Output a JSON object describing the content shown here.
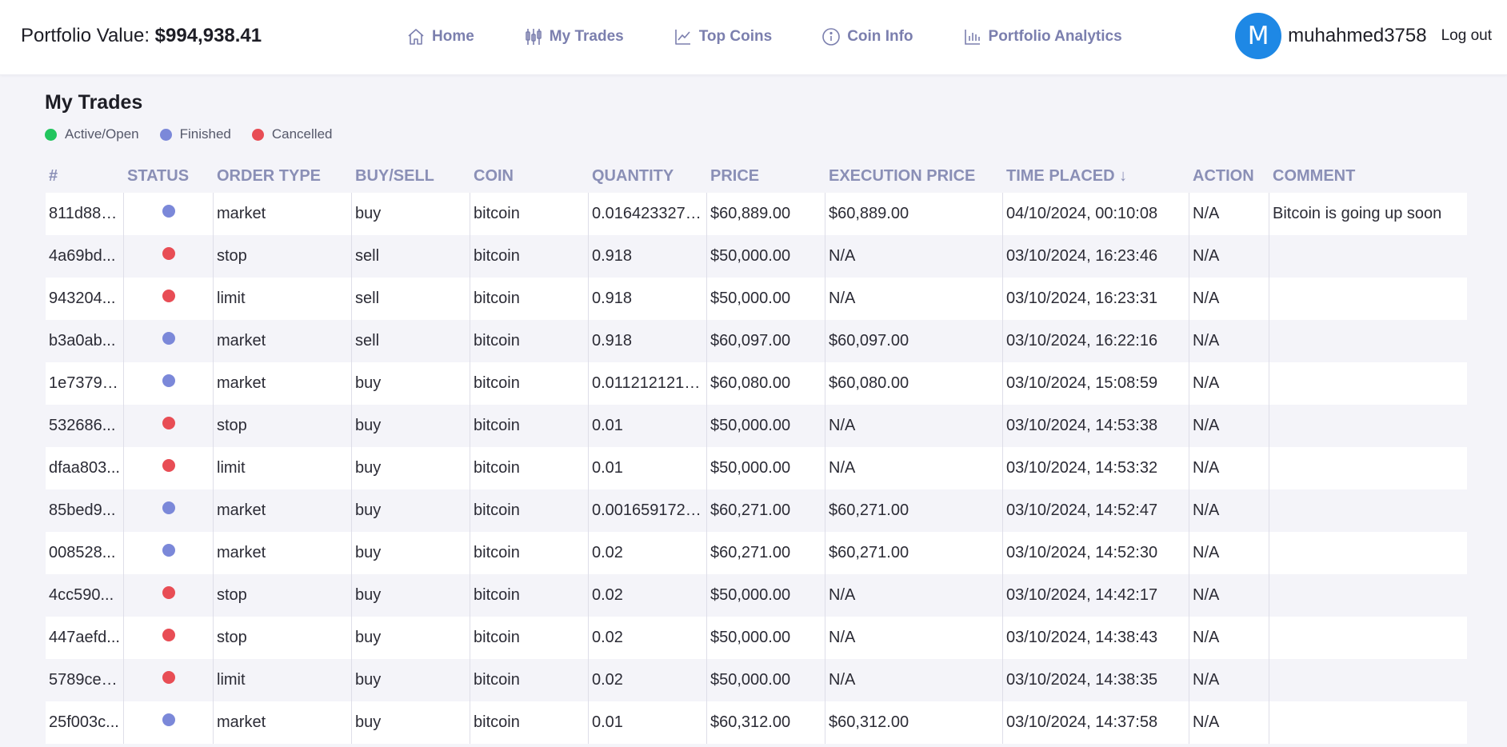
{
  "header": {
    "portfolio_label": "Portfolio Value:",
    "portfolio_value": "$994,938.41",
    "nav": [
      {
        "label": "Home",
        "icon": "home-icon"
      },
      {
        "label": "My Trades",
        "icon": "trades-icon"
      },
      {
        "label": "Top Coins",
        "icon": "chart-line-icon"
      },
      {
        "label": "Coin Info",
        "icon": "info-icon"
      },
      {
        "label": "Portfolio Analytics",
        "icon": "bar-chart-icon"
      }
    ],
    "avatar_letter": "M",
    "username": "muhahmed3758",
    "logout": "Log out"
  },
  "page": {
    "title": "My Trades",
    "legend": [
      {
        "label": "Active/Open",
        "color": "#22c55e"
      },
      {
        "label": "Finished",
        "color": "#7b88d9"
      },
      {
        "label": "Cancelled",
        "color": "#e84d55"
      }
    ]
  },
  "colors": {
    "finished": "#7b88d9",
    "cancelled": "#e84d55",
    "nav_text": "#7b7fae",
    "header_text": "#8a8fb6",
    "avatar": "#1e88e5"
  },
  "table": {
    "columns": [
      "#",
      "STATUS",
      "ORDER TYPE",
      "BUY/SELL",
      "COIN",
      "QUANTITY",
      "PRICE",
      "EXECUTION PRICE",
      "TIME PLACED ↓",
      "ACTION",
      "COMMENT"
    ],
    "rows": [
      {
        "id": "811d88e...",
        "status": "finished",
        "order_type": "market",
        "side": "buy",
        "coin": "bitcoin",
        "quantity": "0.0164233276...",
        "price": "$60,889.00",
        "exec_price": "$60,889.00",
        "time": "04/10/2024, 00:10:08",
        "action": "N/A",
        "comment": "Bitcoin is going up soon"
      },
      {
        "id": "4a69bd...",
        "status": "cancelled",
        "order_type": "stop",
        "side": "sell",
        "coin": "bitcoin",
        "quantity": "0.918",
        "price": "$50,000.00",
        "exec_price": "N/A",
        "time": "03/10/2024, 16:23:46",
        "action": "N/A",
        "comment": ""
      },
      {
        "id": "943204...",
        "status": "cancelled",
        "order_type": "limit",
        "side": "sell",
        "coin": "bitcoin",
        "quantity": "0.918",
        "price": "$50,000.00",
        "exec_price": "N/A",
        "time": "03/10/2024, 16:23:31",
        "action": "N/A",
        "comment": ""
      },
      {
        "id": "b3a0ab...",
        "status": "finished",
        "order_type": "market",
        "side": "sell",
        "coin": "bitcoin",
        "quantity": "0.918",
        "price": "$60,097.00",
        "exec_price": "$60,097.00",
        "time": "03/10/2024, 16:22:16",
        "action": "N/A",
        "comment": ""
      },
      {
        "id": "1e73791...",
        "status": "finished",
        "order_type": "market",
        "side": "buy",
        "coin": "bitcoin",
        "quantity": "0.0112121212121...",
        "price": "$60,080.00",
        "exec_price": "$60,080.00",
        "time": "03/10/2024, 15:08:59",
        "action": "N/A",
        "comment": ""
      },
      {
        "id": "532686...",
        "status": "cancelled",
        "order_type": "stop",
        "side": "buy",
        "coin": "bitcoin",
        "quantity": "0.01",
        "price": "$50,000.00",
        "exec_price": "N/A",
        "time": "03/10/2024, 14:53:38",
        "action": "N/A",
        "comment": ""
      },
      {
        "id": "dfaa803...",
        "status": "cancelled",
        "order_type": "limit",
        "side": "buy",
        "coin": "bitcoin",
        "quantity": "0.01",
        "price": "$50,000.00",
        "exec_price": "N/A",
        "time": "03/10/2024, 14:53:32",
        "action": "N/A",
        "comment": ""
      },
      {
        "id": "85bed9...",
        "status": "finished",
        "order_type": "market",
        "side": "buy",
        "coin": "bitcoin",
        "quantity": "0.0016591727...",
        "price": "$60,271.00",
        "exec_price": "$60,271.00",
        "time": "03/10/2024, 14:52:47",
        "action": "N/A",
        "comment": ""
      },
      {
        "id": "008528...",
        "status": "finished",
        "order_type": "market",
        "side": "buy",
        "coin": "bitcoin",
        "quantity": "0.02",
        "price": "$60,271.00",
        "exec_price": "$60,271.00",
        "time": "03/10/2024, 14:52:30",
        "action": "N/A",
        "comment": ""
      },
      {
        "id": "4cc590...",
        "status": "cancelled",
        "order_type": "stop",
        "side": "buy",
        "coin": "bitcoin",
        "quantity": "0.02",
        "price": "$50,000.00",
        "exec_price": "N/A",
        "time": "03/10/2024, 14:42:17",
        "action": "N/A",
        "comment": ""
      },
      {
        "id": "447aefd...",
        "status": "cancelled",
        "order_type": "stop",
        "side": "buy",
        "coin": "bitcoin",
        "quantity": "0.02",
        "price": "$50,000.00",
        "exec_price": "N/A",
        "time": "03/10/2024, 14:38:43",
        "action": "N/A",
        "comment": ""
      },
      {
        "id": "5789ce2...",
        "status": "cancelled",
        "order_type": "limit",
        "side": "buy",
        "coin": "bitcoin",
        "quantity": "0.02",
        "price": "$50,000.00",
        "exec_price": "N/A",
        "time": "03/10/2024, 14:38:35",
        "action": "N/A",
        "comment": ""
      },
      {
        "id": "25f003c...",
        "status": "finished",
        "order_type": "market",
        "side": "buy",
        "coin": "bitcoin",
        "quantity": "0.01",
        "price": "$60,312.00",
        "exec_price": "$60,312.00",
        "time": "03/10/2024, 14:37:58",
        "action": "N/A",
        "comment": ""
      }
    ]
  }
}
